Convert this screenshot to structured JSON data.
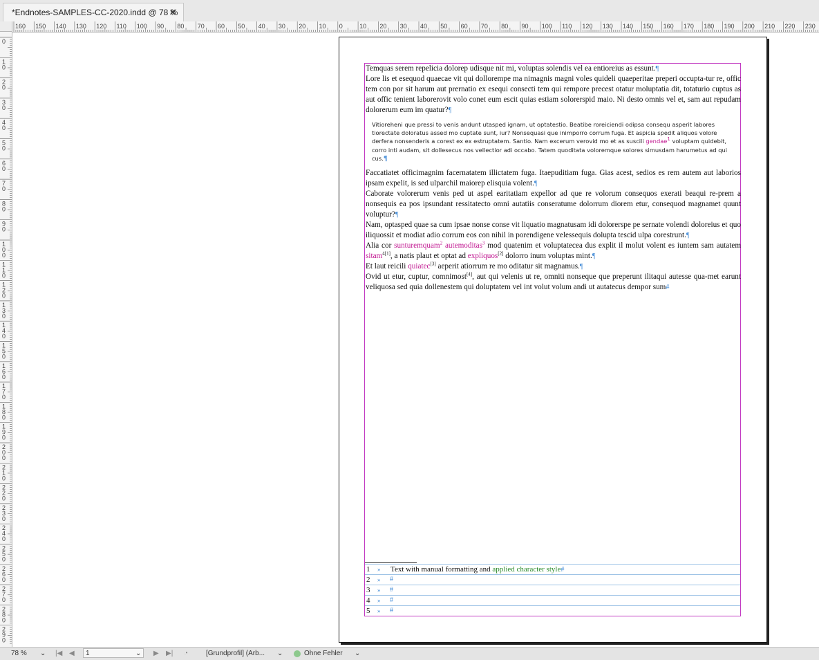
{
  "tab": {
    "title": "*Endnotes-SAMPLES-CC-2020.indd @ 78 %",
    "close": "✕"
  },
  "ruler_h_labels": [
    "160",
    "150",
    "140",
    "130",
    "120",
    "110",
    "100",
    "90",
    "80",
    "70",
    "60",
    "50",
    "40",
    "30",
    "20",
    "10",
    "0",
    "10",
    "20",
    "30",
    "40",
    "50",
    "60",
    "70",
    "80",
    "90",
    "100",
    "110",
    "120",
    "130",
    "140",
    "150",
    "160",
    "170",
    "180",
    "190",
    "200",
    "210",
    "220",
    "230"
  ],
  "ruler_v_labels": [
    "0",
    "10",
    "20",
    "30",
    "40",
    "50",
    "60",
    "70",
    "80",
    "90",
    "100",
    "110",
    "120",
    "130",
    "140",
    "150",
    "160",
    "170",
    "180",
    "190",
    "200",
    "210",
    "220",
    "230",
    "240",
    "250",
    "260",
    "270",
    "280",
    "290"
  ],
  "pilcrow": "¶",
  "story_end": "#",
  "body": {
    "p1": "Temquas serem repelicia dolorep udisque nit mi, voluptas solendis vel ea entioreius as essunt.",
    "p2": "Lore lis et esequod quaecae vit qui dollorempe ma nimagnis magni voles quideli quaeperitae preperi occupta-tur re, offic tem con por sit harum aut prernatio ex esequi consecti tem qui rempore precest otatur moluptatia dit, totaturio cuptus as aut offic tenient laborerovit volo conet eum escit quias estiam solorerspid maio. Ni desto omnis vel et, sam aut repudam dolorerum eum im quatur?",
    "quote_a": "Vitioreheni que pressi to venis andunt utasped ignam, ut optatestio. Beatibe roreiciendi odipsa consequ asperit labores tiorectate doloratus assed mo cuptate sunt, iur? Nonsequasi que inimporro corrum fuga. Et aspicia spedit aliquos volore derfera nonsenderis a corest ex ex estruptatem. Santio. Nam excerum verovid mo et as suscili ",
    "quote_mag": "gendae",
    "quote_sup": "1",
    "quote_b": " voluptam quidebit, corro inti audam, sit dollesecus nos vellectior adi occabo. Tatem quoditata voloremque solores simusdam harumetus ad qui cus.",
    "p3": "Faccatiatet officimagnim facernatatem illictatem fuga. Itaepuditiam fuga. Gias acest, sedios es rem autem aut laborios ipsam expelit, is sed ulparchil maiorep elisquia volent.",
    "p4": "Caborate volorerum venis ped ut aspel earitatiam expellor ad que re volorum consequos exerati beaqui re-prem a nonsequis ea pos ipsundant ressitatecto omni autatiis conseratume dolorrum diorem etur, consequod magnamet quunt voluptur?",
    "p5": "Nam, optasped quae sa cum ipsae nonse conse vit liquatio magnatusam idi dolorerspe pe sernate volendi doloreius et quo iliquossit et modiat adio corrum eos con nihil in porendigene velessequis dolupta tescid ulpa corestrunt.",
    "p6_a": "Alia cor ",
    "p6_m1": "sunturemquam",
    "p6_s1": "2",
    "p6_m2": "autemoditas",
    "p6_s2": "3",
    "p6_b": " mod quatenim et voluptatecea dus explit il molut volent es iuntem sam autatem ",
    "p6_m3": "sitam",
    "p6_s3": "4[1]",
    "p6_c": ", a natis plaut et optat ad ",
    "p6_m4": "expliquos",
    "p6_s4": "[2]",
    "p6_d": " dolorro inum voluptas mint.",
    "p7_a": "Et laut reicili ",
    "p7_m": "quiatec",
    "p7_s": "[3]",
    "p7_b": " aeperit atiorrum re mo oditatur sit magnamus.",
    "p8_a": "Ovid ut etur, cuptur, comnimost",
    "p8_s": "[4]",
    "p8_b": ", aut qui velenis ut re, omniti nonseque que preperunt ilitaqui autesse qua-met earunt veliquosa sed quia dollenestem qui doluptatem vel int volut volum andi ut autatecus dempor sum"
  },
  "endnotes": [
    {
      "num": "1",
      "arrow": "»",
      "text": "Text with manual formatting and ",
      "styled": "applied character style"
    },
    {
      "num": "2",
      "arrow": "»"
    },
    {
      "num": "3",
      "arrow": "»"
    },
    {
      "num": "4",
      "arrow": "»"
    },
    {
      "num": "5",
      "arrow": "»"
    }
  ],
  "status": {
    "zoom": "78 %",
    "page": "1",
    "profile": "[Grundprofil] (Arb...",
    "errors": "Ohne Fehler"
  },
  "colors": {
    "frame": "#c23ac2",
    "magenta_style": "#c0148f",
    "green_style": "#2a8a2a",
    "hidden_chars": "#4a90d9",
    "ok_dot": "#8dc98d"
  },
  "icons": [
    "close-icon",
    "chevron-down-icon",
    "first-page-icon",
    "previous-page-icon",
    "next-page-icon",
    "last-page-icon",
    "preflight-tool-icon",
    "status-ok-dot-icon"
  ]
}
